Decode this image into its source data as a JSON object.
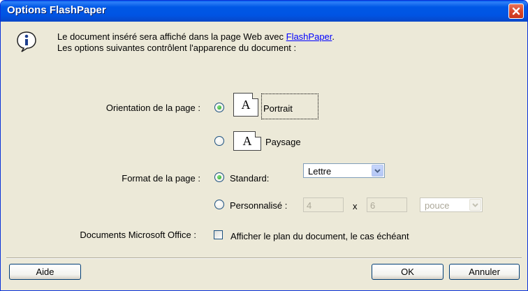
{
  "window": {
    "title": "Options FlashPaper",
    "close_icon": "close-icon"
  },
  "info": {
    "line1_prefix": "Le document inséré sera affiché dans la page Web avec ",
    "line1_link": "FlashPaper",
    "line1_suffix": ".",
    "line2": "Les options suivantes contrôlent l'apparence du document :"
  },
  "orientation": {
    "label": "Orientation de la page :",
    "portrait_label": "Portrait",
    "paysage_label": "Paysage",
    "page_glyph": "A",
    "selected": "portrait"
  },
  "format": {
    "label": "Format de la page :",
    "standard_label": "Standard:",
    "standard_value": "Lettre",
    "custom_label": "Personnalisé :",
    "width_value": "4",
    "times": "x",
    "height_value": "6",
    "unit_value": "pouce",
    "selected": "standard"
  },
  "office": {
    "label": "Documents Microsoft Office :",
    "checkbox_label": "Afficher le plan du document, le cas échéant",
    "checked": false
  },
  "buttons": {
    "help": "Aide",
    "ok": "OK",
    "cancel": "Annuler"
  },
  "colors": {
    "titlebar": "#0054e3",
    "dialog_bg": "#ece9d8",
    "link": "#0000ff"
  }
}
